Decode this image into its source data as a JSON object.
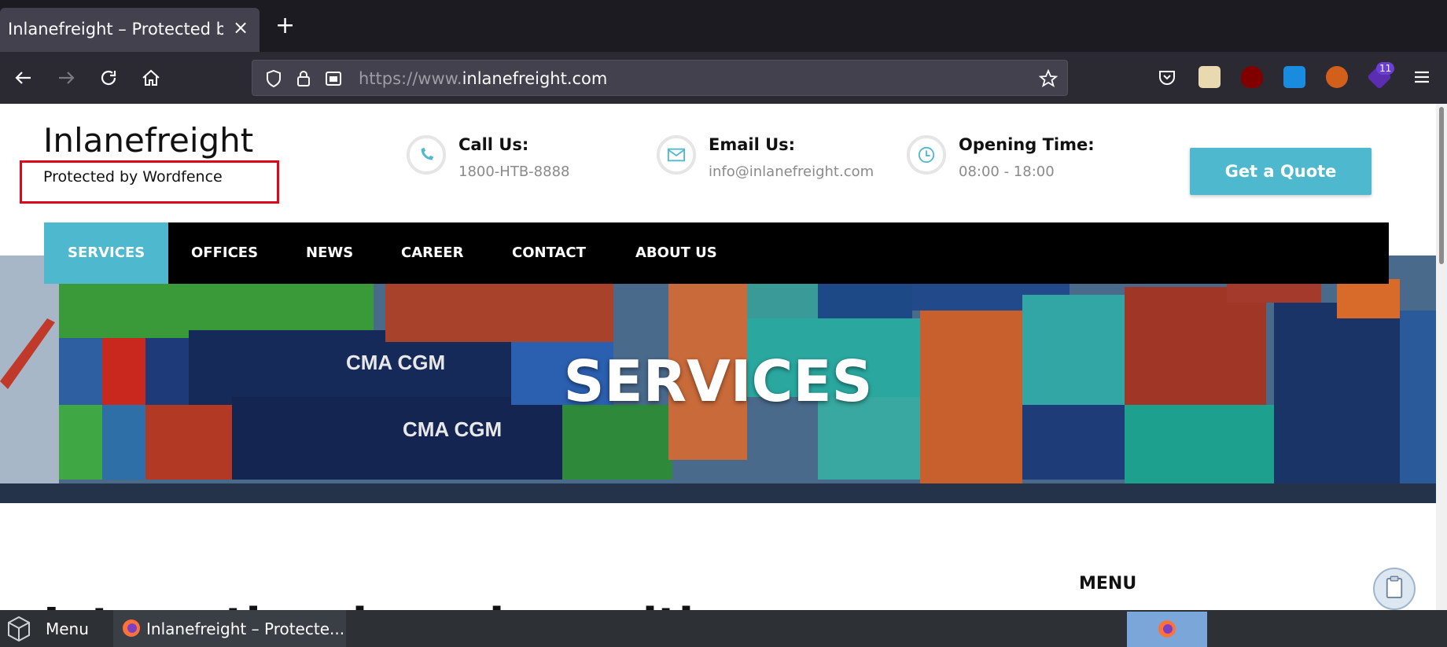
{
  "browser": {
    "tab_title": "Inlanefreight – Protected by W",
    "tab_close": "×",
    "new_tab": "+",
    "url_prefix": "https://www.",
    "url_host": "inlanefreight.com",
    "badge_count": "11"
  },
  "site": {
    "title": "Inlanefreight",
    "tagline": "Protected by Wordfence",
    "contacts": [
      {
        "label": "Call Us:",
        "value": "1800-HTB-8888",
        "icon": "phone-icon"
      },
      {
        "label": "Email Us:",
        "value": "info@inlanefreight.com",
        "icon": "envelope-icon"
      },
      {
        "label": "Opening Time:",
        "value": "08:00 - 18:00",
        "icon": "clock-icon"
      }
    ],
    "quote_button": "Get a Quote",
    "menu": [
      "SERVICES",
      "OFFICES",
      "NEWS",
      "CAREER",
      "CONTACT",
      "ABOUT US"
    ],
    "hero_title": "SERVICES",
    "hero_container_texts": [
      "CMA CGM",
      "CMA CGM"
    ],
    "side_menu_title": "MENU",
    "partial_heading": "International services with a dense and rel"
  },
  "taskbar": {
    "menu_label": "Menu",
    "task_label": "Inlanefreight – Protecte..."
  },
  "colors": {
    "accent": "#4eb8ce",
    "highlight_box": "#e1071b"
  }
}
